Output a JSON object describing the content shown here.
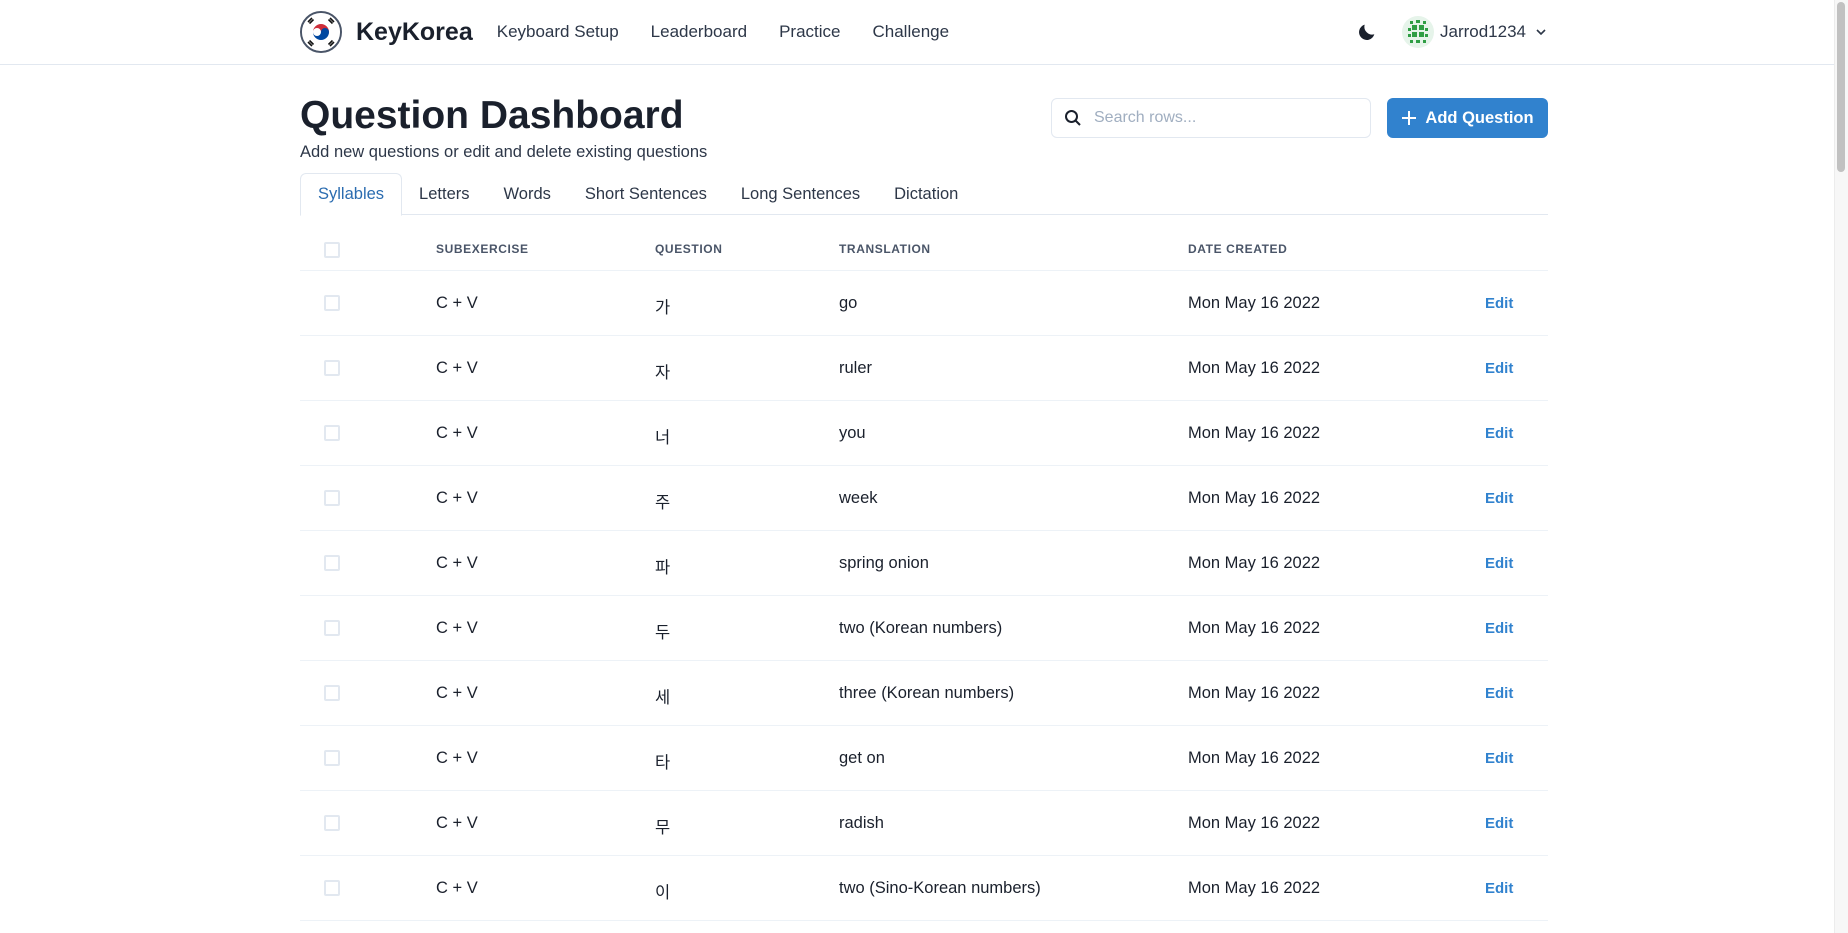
{
  "navbar": {
    "brand": "KeyKorea",
    "links": [
      "Keyboard Setup",
      "Leaderboard",
      "Practice",
      "Challenge"
    ],
    "username": "Jarrod1234"
  },
  "page": {
    "title": "Question Dashboard",
    "subtitle": "Add new questions or edit and delete existing questions"
  },
  "search": {
    "placeholder": "Search rows..."
  },
  "add_button": {
    "label": "Add Question"
  },
  "tabs": [
    "Syllables",
    "Letters",
    "Words",
    "Short Sentences",
    "Long Sentences",
    "Dictation"
  ],
  "active_tab": "Syllables",
  "table": {
    "columns": [
      "Subexercise",
      "Question",
      "Translation",
      "Date Created"
    ],
    "edit_label": "Edit",
    "rows": [
      {
        "subexercise": "C + V",
        "question": "가",
        "translation": "go",
        "date": "Mon May 16 2022"
      },
      {
        "subexercise": "C + V",
        "question": "자",
        "translation": "ruler",
        "date": "Mon May 16 2022"
      },
      {
        "subexercise": "C + V",
        "question": "너",
        "translation": "you",
        "date": "Mon May 16 2022"
      },
      {
        "subexercise": "C + V",
        "question": "주",
        "translation": "week",
        "date": "Mon May 16 2022"
      },
      {
        "subexercise": "C + V",
        "question": "파",
        "translation": "spring onion",
        "date": "Mon May 16 2022"
      },
      {
        "subexercise": "C + V",
        "question": "두",
        "translation": "two (Korean numbers)",
        "date": "Mon May 16 2022"
      },
      {
        "subexercise": "C + V",
        "question": "세",
        "translation": "three (Korean numbers)",
        "date": "Mon May 16 2022"
      },
      {
        "subexercise": "C + V",
        "question": "타",
        "translation": "get on",
        "date": "Mon May 16 2022"
      },
      {
        "subexercise": "C + V",
        "question": "무",
        "translation": "radish",
        "date": "Mon May 16 2022"
      },
      {
        "subexercise": "C + V",
        "question": "이",
        "translation": "two (Sino-Korean numbers)",
        "date": "Mon May 16 2022"
      }
    ]
  },
  "colors": {
    "accent": "#3182ce",
    "active_tab_text": "#2b6cb0",
    "border": "#e2e8f0"
  },
  "icons": [
    "korean-flag-logo-icon",
    "moon-icon",
    "avatar-icon",
    "chevron-down-icon",
    "search-icon",
    "plus-icon"
  ]
}
